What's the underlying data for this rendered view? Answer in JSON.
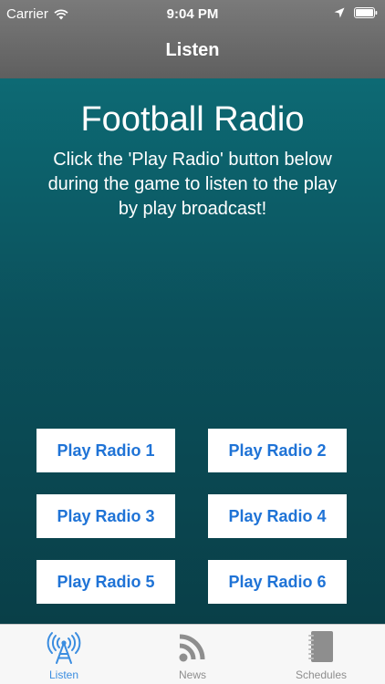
{
  "status_bar": {
    "carrier": "Carrier",
    "time": "9:04 PM"
  },
  "nav": {
    "title": "Listen"
  },
  "main": {
    "title": "Football Radio",
    "subtitle": "Click the 'Play Radio' button below during the game to listen to the play by play broadcast!",
    "buttons": [
      "Play Radio 1",
      "Play Radio 2",
      "Play Radio 3",
      "Play Radio 4",
      "Play Radio 5",
      "Play Radio 6"
    ]
  },
  "tabs": [
    {
      "label": "Listen",
      "icon": "radio-tower-icon",
      "active": true
    },
    {
      "label": "News",
      "icon": "rss-icon",
      "active": false
    },
    {
      "label": "Schedules",
      "icon": "notebook-icon",
      "active": false
    }
  ],
  "colors": {
    "accent": "#1f73d6",
    "tab_active": "#3b8de0",
    "tab_inactive": "#8e8e8e",
    "background_top": "#0d6a74",
    "background_bottom": "#093f48"
  }
}
